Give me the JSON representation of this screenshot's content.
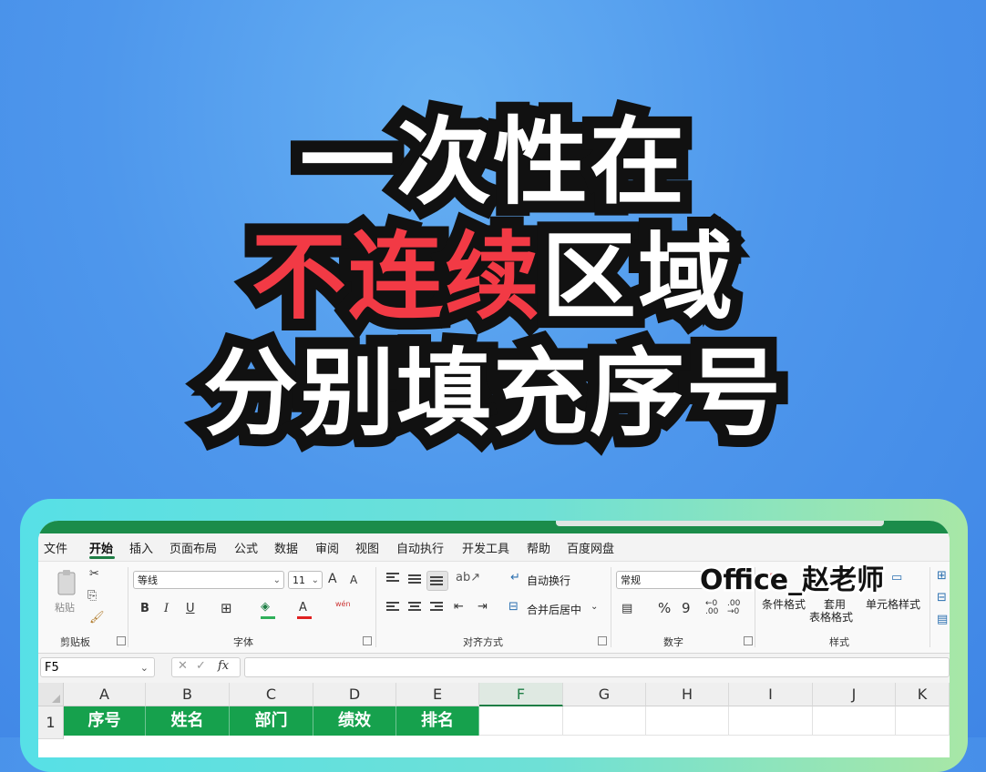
{
  "title": {
    "line1": "一次性在",
    "line2_red": "不连续",
    "line2_rest": "区域",
    "line3": "分别填充序号"
  },
  "colors": {
    "background": "#4e97ec",
    "title_red": "#f23a45",
    "header_green": "#16a14d",
    "frame_teal": "#57e0e6"
  },
  "watermark": "Office_赵老师",
  "menu": [
    "文件",
    "开始",
    "插入",
    "页面布局",
    "公式",
    "数据",
    "审阅",
    "视图",
    "自动执行",
    "开发工具",
    "帮助",
    "百度网盘"
  ],
  "menu_active": "开始",
  "ribbon": {
    "clipboard": {
      "paste": "粘贴",
      "label": "剪贴板"
    },
    "font": {
      "name": "等线",
      "size": "11",
      "bold": "B",
      "italic": "I",
      "underline": "U",
      "label": "字体",
      "grow": "A",
      "shrink": "A",
      "color_a": "A",
      "pinyin": "wén"
    },
    "alignment": {
      "wrap": "自动换行",
      "merge": "合并后居中",
      "label": "对齐方式"
    },
    "number": {
      "format": "常规",
      "percent": "%",
      "comma": "9",
      "label": "数字"
    },
    "styles": {
      "conditional": "条件格式",
      "table_1": "套用",
      "table_2": "表格格式",
      "cell": "单元格样式",
      "label": "样式"
    }
  },
  "formula_bar": {
    "name_box": "F5",
    "fx": "fx"
  },
  "grid": {
    "columns": [
      "A",
      "B",
      "C",
      "D",
      "E",
      "F",
      "G",
      "H",
      "I",
      "J",
      "K"
    ],
    "selected_column": "F",
    "rows": [
      "1"
    ],
    "header_row": [
      "序号",
      "姓名",
      "部门",
      "绩效",
      "排名"
    ]
  }
}
